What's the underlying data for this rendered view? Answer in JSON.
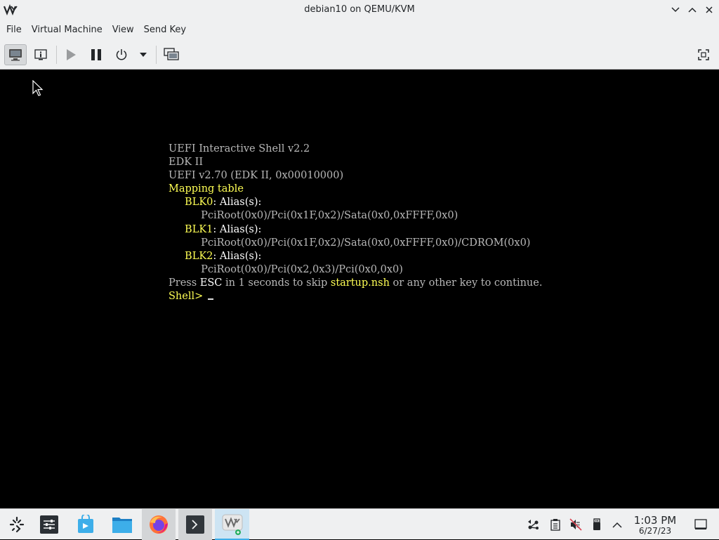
{
  "window": {
    "title": "debian10 on QEMU/KVM",
    "app_icon": "virt-manager-logo-icon"
  },
  "menu": {
    "items": [
      "File",
      "Virtual Machine",
      "View",
      "Send Key"
    ]
  },
  "toolbar": {
    "buttons": [
      {
        "name": "console-view-button",
        "icon": "monitor-icon",
        "active": true
      },
      {
        "name": "details-view-button",
        "icon": "info-icon",
        "active": false
      },
      {
        "name": "run-button",
        "icon": "play-icon",
        "active": false
      },
      {
        "name": "pause-button",
        "icon": "pause-icon",
        "active": false
      },
      {
        "name": "shutdown-button",
        "icon": "power-icon",
        "active": false
      },
      {
        "name": "shutdown-menu-button",
        "icon": "dropdown-arrow-icon",
        "active": false
      },
      {
        "name": "snapshots-button",
        "icon": "snapshot-icon",
        "active": false
      },
      {
        "name": "fullscreen-button",
        "icon": "fullscreen-icon",
        "active": false
      }
    ]
  },
  "console": {
    "lines": [
      {
        "indent": "",
        "segments": [
          {
            "t": "UEFI Interactive Shell v2.2",
            "c": "g"
          }
        ]
      },
      {
        "indent": "",
        "segments": [
          {
            "t": "EDK II",
            "c": "g"
          }
        ]
      },
      {
        "indent": "",
        "segments": [
          {
            "t": "UEFI v2.70 (EDK II, 0x00010000)",
            "c": "g"
          }
        ]
      },
      {
        "indent": "",
        "segments": [
          {
            "t": "Mapping table",
            "c": "y"
          }
        ]
      },
      {
        "indent": "     ",
        "segments": [
          {
            "t": "BLK0",
            "c": "y"
          },
          {
            "t": ": Alias(s):",
            "c": "w"
          }
        ]
      },
      {
        "indent": "          ",
        "segments": [
          {
            "t": "PciRoot(0x0)/Pci(0x1F,0x2)/Sata(0x0,0xFFFF,0x0)",
            "c": "g"
          }
        ]
      },
      {
        "indent": "     ",
        "segments": [
          {
            "t": "BLK1",
            "c": "y"
          },
          {
            "t": ": Alias(s):",
            "c": "w"
          }
        ]
      },
      {
        "indent": "          ",
        "segments": [
          {
            "t": "PciRoot(0x0)/Pci(0x1F,0x2)/Sata(0x0,0xFFFF,0x0)/CDROM(0x0)",
            "c": "g"
          }
        ]
      },
      {
        "indent": "     ",
        "segments": [
          {
            "t": "BLK2",
            "c": "y"
          },
          {
            "t": ": Alias(s):",
            "c": "w"
          }
        ]
      },
      {
        "indent": "          ",
        "segments": [
          {
            "t": "PciRoot(0x0)/Pci(0x2,0x3)/Pci(0x0,0x0)",
            "c": "g"
          }
        ]
      },
      {
        "indent": "",
        "segments": [
          {
            "t": "Press ",
            "c": "g"
          },
          {
            "t": "ESC",
            "c": "w"
          },
          {
            "t": " in 1 seconds to skip ",
            "c": "g"
          },
          {
            "t": "startup.nsh",
            "c": "y"
          },
          {
            "t": " or any other key to continue.",
            "c": "g"
          }
        ]
      },
      {
        "indent": "",
        "segments": [
          {
            "t": "Shell> ",
            "c": "y"
          }
        ]
      }
    ]
  },
  "taskbar": {
    "apps": [
      {
        "name": "app-launcher-icon"
      },
      {
        "name": "system-settings-icon"
      },
      {
        "name": "discover-store-icon"
      },
      {
        "name": "file-manager-icon"
      },
      {
        "name": "firefox-icon"
      },
      {
        "name": "terminal-icon"
      },
      {
        "name": "virt-manager-task-icon"
      }
    ],
    "tray": [
      "network-icon",
      "clipboard-icon",
      "volume-muted-icon",
      "usb-device-icon",
      "tray-expand-icon"
    ],
    "clock_time": "1:03 PM",
    "clock_date": "6/27/23"
  },
  "colors": {
    "gray_text": "#b8b8b8",
    "yellow_text": "#ffff54",
    "white_text": "#ffffff",
    "chrome_bg": "#eff0f1",
    "accent": "#3daee9"
  }
}
